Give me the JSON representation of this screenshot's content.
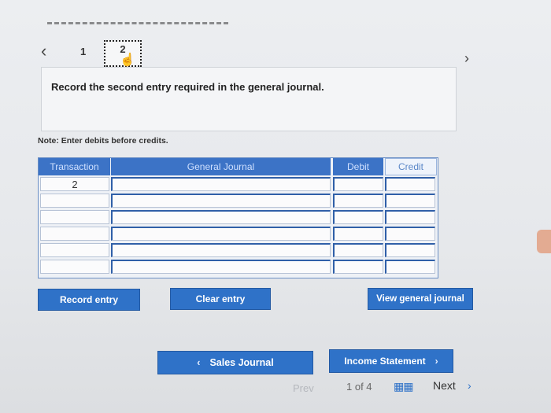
{
  "nav": {
    "prev_icon": "chevron-left-icon",
    "next_icon": "chevron-right-icon",
    "steps": [
      "1",
      "2"
    ],
    "current_step": "2"
  },
  "prompt": {
    "text": "Record the second entry required in the general journal."
  },
  "note": "Note: Enter debits before credits.",
  "journal": {
    "headers": {
      "transaction": "Transaction",
      "general_journal": "General Journal",
      "debit": "Debit",
      "credit": "Credit"
    },
    "rows": [
      {
        "transaction": "2",
        "account": "",
        "debit": "",
        "credit": ""
      },
      {
        "transaction": "",
        "account": "",
        "debit": "",
        "credit": ""
      },
      {
        "transaction": "",
        "account": "",
        "debit": "",
        "credit": ""
      },
      {
        "transaction": "",
        "account": "",
        "debit": "",
        "credit": ""
      },
      {
        "transaction": "",
        "account": "",
        "debit": "",
        "credit": ""
      },
      {
        "transaction": "",
        "account": "",
        "debit": "",
        "credit": ""
      }
    ]
  },
  "buttons": {
    "record_entry": "Record entry",
    "clear_entry": "Clear entry",
    "view_general_journal": "View general journal"
  },
  "bottom_nav": {
    "back_label": "Sales Journal",
    "forward_label": "Income Statement"
  },
  "pager": {
    "prev": "Prev",
    "count": "1 of 4",
    "next": "Next"
  },
  "colors": {
    "accent": "#2f72c8",
    "header": "#3c73c6"
  }
}
